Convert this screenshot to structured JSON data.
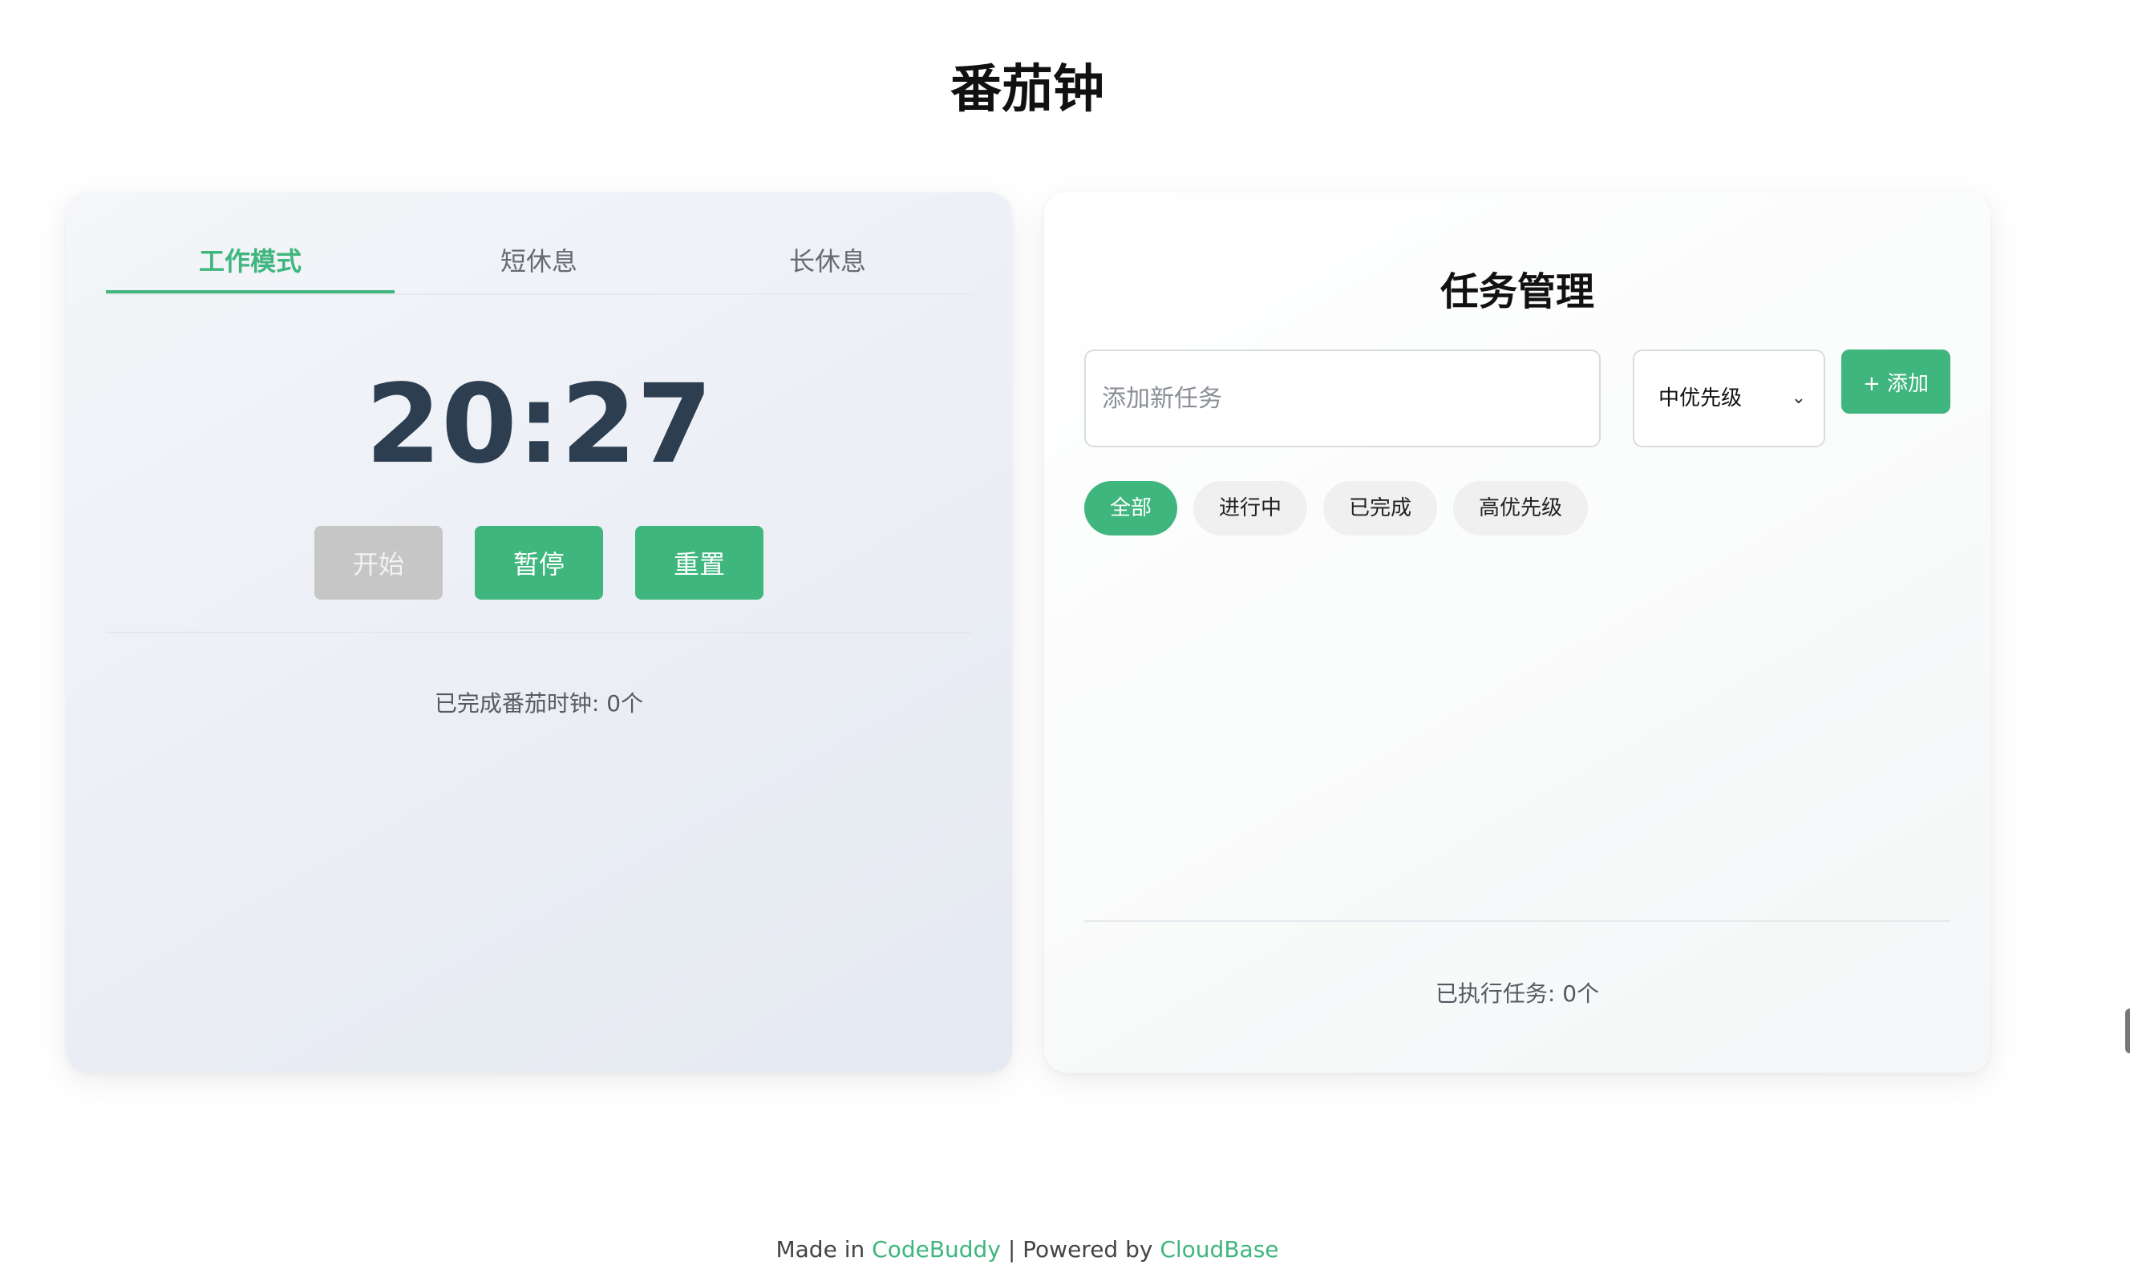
{
  "page": {
    "title": "番茄钟"
  },
  "timer": {
    "tabs": [
      {
        "label": "工作模式",
        "active": true
      },
      {
        "label": "短休息",
        "active": false
      },
      {
        "label": "长休息",
        "active": false
      }
    ],
    "time": "20:27",
    "buttons": {
      "start": "开始",
      "pause": "暂停",
      "reset": "重置"
    },
    "completed_text": "已完成番茄时钟: 0个"
  },
  "tasks": {
    "title": "任务管理",
    "input_placeholder": "添加新任务",
    "priority_selected": "中优先级",
    "add_label": "+ 添加",
    "filters": [
      {
        "label": "全部",
        "active": true
      },
      {
        "label": "进行中",
        "active": false
      },
      {
        "label": "已完成",
        "active": false
      },
      {
        "label": "高优先级",
        "active": false
      }
    ],
    "executed_text": "已执行任务: 0个"
  },
  "footer": {
    "made_in": "Made in",
    "codebuddy": "CodeBuddy",
    "separator": "| Powered by",
    "cloudbase": "CloudBase"
  },
  "colors": {
    "accent": "#3fb67d",
    "timer_text": "#2c3e50",
    "disabled_button": "#c6c6c6"
  }
}
